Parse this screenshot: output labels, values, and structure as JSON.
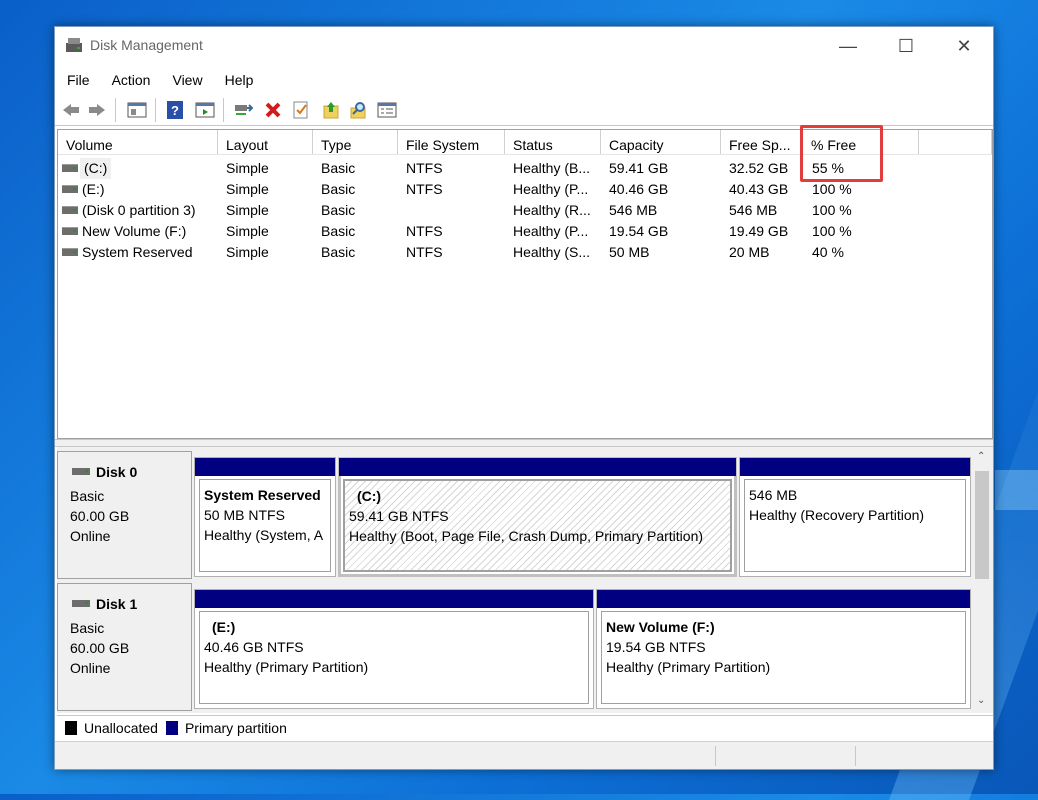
{
  "window": {
    "title": "Disk Management"
  },
  "menu": [
    "File",
    "Action",
    "View",
    "Help"
  ],
  "toolbar": [
    "back-icon",
    "forward-icon",
    "properties-list-icon",
    "help-icon",
    "console-view-icon",
    "connect-icon",
    "delete-icon",
    "check-icon",
    "up-folder-icon",
    "search-icon",
    "settings-list-icon"
  ],
  "volume_table": {
    "columns": [
      "Volume",
      "Layout",
      "Type",
      "File System",
      "Status",
      "Capacity",
      "Free Sp...",
      "% Free"
    ],
    "rows": [
      [
        "(C:)",
        "Simple",
        "Basic",
        "NTFS",
        "Healthy (B...",
        "59.41 GB",
        "32.52 GB",
        "55 %"
      ],
      [
        "(E:)",
        "Simple",
        "Basic",
        "NTFS",
        "Healthy (P...",
        "40.46 GB",
        "40.43 GB",
        "100 %"
      ],
      [
        "(Disk 0 partition 3)",
        "Simple",
        "Basic",
        "",
        "Healthy (R...",
        "546 MB",
        "546 MB",
        "100 %"
      ],
      [
        "New Volume (F:)",
        "Simple",
        "Basic",
        "NTFS",
        "Healthy (P...",
        "19.54 GB",
        "19.49 GB",
        "100 %"
      ],
      [
        "System Reserved",
        "Simple",
        "Basic",
        "NTFS",
        "Healthy (S...",
        "50 MB",
        "20 MB",
        "40 %"
      ]
    ]
  },
  "disks": [
    {
      "name": "Disk 0",
      "type": "Basic",
      "size": "60.00 GB",
      "state": "Online",
      "partitions": [
        {
          "title": "System Reserved",
          "fs": "50 MB NTFS",
          "status": "Healthy (System, A"
        },
        {
          "title": "(C:)",
          "fs": "59.41 GB NTFS",
          "status": "Healthy (Boot, Page File, Crash Dump, Primary Partition)"
        },
        {
          "title": "",
          "fs": "546 MB",
          "status": "Healthy (Recovery Partition)"
        }
      ]
    },
    {
      "name": "Disk 1",
      "type": "Basic",
      "size": "60.00 GB",
      "state": "Online",
      "partitions": [
        {
          "title": "(E:)",
          "fs": "40.46 GB NTFS",
          "status": "Healthy (Primary Partition)"
        },
        {
          "title": "New Volume  (F:)",
          "fs": "19.54 GB NTFS",
          "status": "Healthy (Primary Partition)"
        }
      ]
    }
  ],
  "legend": [
    {
      "label": "Unallocated",
      "color": "#000000"
    },
    {
      "label": "Primary partition",
      "color": "#000080"
    }
  ]
}
